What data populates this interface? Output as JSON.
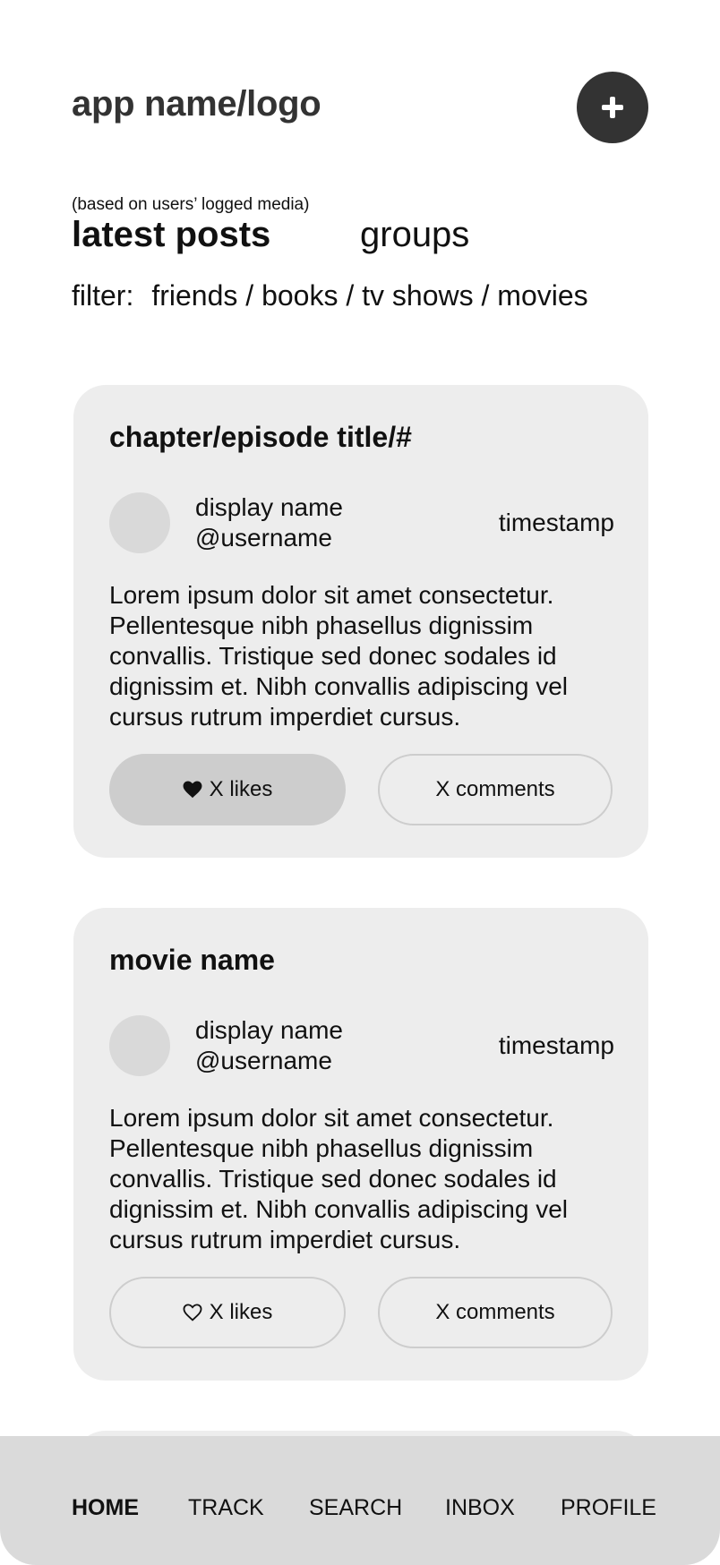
{
  "header": {
    "app_title": "app name/logo",
    "add_button_icon": "plus-icon"
  },
  "feed_header": {
    "subtitle": "(based on users’ logged media)",
    "tabs": [
      {
        "label": "latest posts",
        "active": true
      },
      {
        "label": "groups",
        "active": false
      }
    ],
    "filter_label": "filter:",
    "filter_options": "friends / books / tv shows / movies"
  },
  "posts": [
    {
      "title": "chapter/episode title/#",
      "display_name": "display name",
      "username": "@username",
      "timestamp": "timestamp",
      "body": "Lorem ipsum dolor sit amet consectetur. Pellentesque nibh phasellus dignissim convallis. Tristique sed donec sodales id dignissim et. Nibh convallis adipiscing vel cursus rutrum imperdiet cursus.",
      "likes_label": "X likes",
      "liked": true,
      "comments_label": "X comments"
    },
    {
      "title": "movie name",
      "display_name": "display name",
      "username": "@username",
      "timestamp": "timestamp",
      "body": "Lorem ipsum dolor sit amet consectetur. Pellentesque nibh phasellus dignissim convallis. Tristique sed donec sodales id dignissim et. Nibh convallis adipiscing vel cursus rutrum imperdiet cursus.",
      "likes_label": "X likes",
      "liked": false,
      "comments_label": "X comments"
    }
  ],
  "bottom_nav": {
    "items": [
      {
        "label": "HOME",
        "active": true
      },
      {
        "label": "TRACK",
        "active": false
      },
      {
        "label": "SEARCH",
        "active": false
      },
      {
        "label": "INBOX",
        "active": false
      },
      {
        "label": "PROFILE",
        "active": false
      }
    ]
  },
  "colors": {
    "primary_dark": "#333333",
    "card_bg": "#ededed",
    "avatar": "#d9d9d9",
    "pill_filled": "#cdcdcd",
    "nav_bg": "#dadada"
  }
}
